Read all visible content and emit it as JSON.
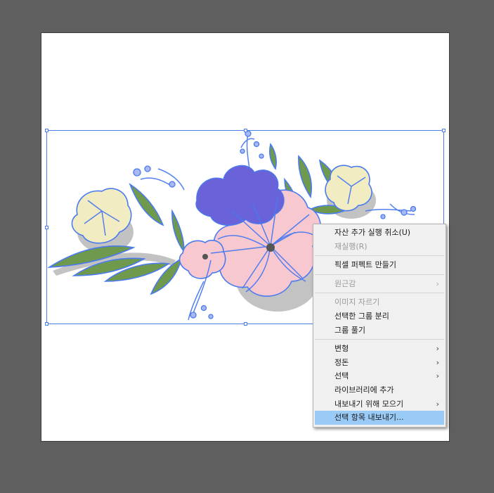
{
  "canvas": {
    "background_color": "#5f5f5f",
    "artboard_color": "#ffffff",
    "selection_color": "#4a7ee8"
  },
  "artwork": {
    "subject": "floral bouquet illustration",
    "colors": {
      "stroke_blue": "#4a7af0",
      "petal_pink": "#f8c8d0",
      "petal_cream": "#f2ecc2",
      "petal_purple": "#6a62d8",
      "leaf_green": "#6f9a4e",
      "shadow_gray": "#b8b8b8"
    }
  },
  "context_menu": {
    "items": [
      {
        "label": "자산 추가 실행 취소(U)",
        "disabled": false,
        "submenu": false
      },
      {
        "label": "재실행(R)",
        "disabled": true,
        "submenu": false
      },
      {
        "separator": true
      },
      {
        "label": "픽셀 퍼펙트 만들기",
        "disabled": false,
        "submenu": false
      },
      {
        "separator": true
      },
      {
        "label": "원근감",
        "disabled": true,
        "submenu": true
      },
      {
        "separator": true
      },
      {
        "label": "이미지 자르기",
        "disabled": true,
        "submenu": false
      },
      {
        "label": "선택한 그룹 분리",
        "disabled": false,
        "submenu": false
      },
      {
        "label": "그룹 풀기",
        "disabled": false,
        "submenu": false
      },
      {
        "separator": true
      },
      {
        "label": "변형",
        "disabled": false,
        "submenu": true
      },
      {
        "label": "정돈",
        "disabled": false,
        "submenu": true
      },
      {
        "label": "선택",
        "disabled": false,
        "submenu": true
      },
      {
        "label": "라이브러리에 추가",
        "disabled": false,
        "submenu": false
      },
      {
        "label": "내보내기 위해 모으기",
        "disabled": false,
        "submenu": true
      },
      {
        "label": "선택 항목 내보내기...",
        "disabled": false,
        "submenu": false,
        "highlighted": true
      }
    ],
    "submenu_arrow": "›",
    "highlight_color": "#99cbf6"
  }
}
